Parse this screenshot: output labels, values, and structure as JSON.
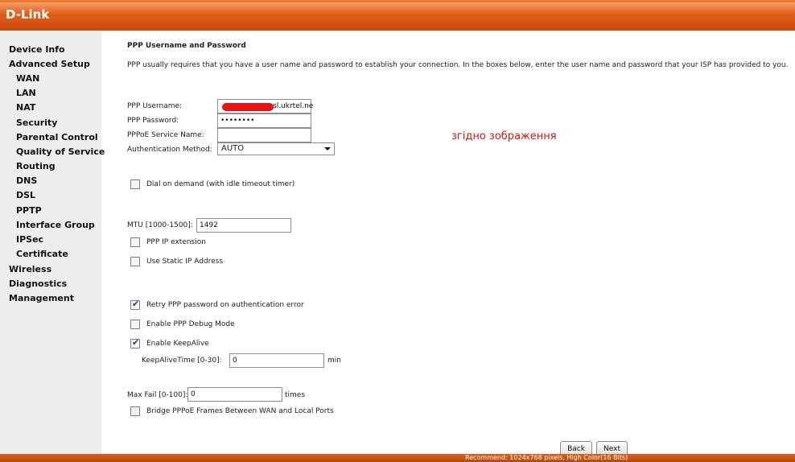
{
  "header": {
    "logo": "D-Link"
  },
  "sidebar": {
    "items": [
      {
        "label": "Device Info"
      },
      {
        "label": "Advanced Setup"
      },
      {
        "label": "WAN"
      },
      {
        "label": "LAN"
      },
      {
        "label": "NAT"
      },
      {
        "label": "Security"
      },
      {
        "label": "Parental Control"
      },
      {
        "label": "Quality of Service"
      },
      {
        "label": "Routing"
      },
      {
        "label": "DNS"
      },
      {
        "label": "DSL"
      },
      {
        "label": "PPTP"
      },
      {
        "label": "Interface Group"
      },
      {
        "label": "IPSec"
      },
      {
        "label": "Certificate"
      },
      {
        "label": "Wireless"
      },
      {
        "label": "Diagnostics"
      },
      {
        "label": "Management"
      }
    ]
  },
  "main": {
    "title": "PPP Username and Password",
    "description": "PPP usually requires that you have a user name and password to establish your connection. In the boxes below, enter the user name and password that your ISP has provided to you.",
    "username_label": "PPP Username:",
    "username_value": "sl.ukrtel.ne",
    "password_label": "PPP Password:",
    "password_value": "••••••••",
    "service_label": "PPPoE Service Name:",
    "service_value": "",
    "auth_label": "Authentication Method:",
    "auth_value": "AUTO",
    "annotation": "згідно зображення",
    "dial_on_demand_label": "Dial on demand (with idle timeout timer)",
    "mtu_label": "MTU [1000-1500]:",
    "mtu_value": "1492",
    "ppp_ip_ext_label": "PPP IP extension",
    "static_ip_label": "Use Static IP Address",
    "retry_label": "Retry PPP password on authentication error",
    "debug_label": "Enable PPP Debug Mode",
    "keepalive_label": "Enable KeepAlive",
    "keepalive_time_label": "KeepAliveTime [0-30]:",
    "keepalive_time_value": "0",
    "keepalive_unit": "min",
    "maxfail_label": "Max Fail [0-100]:",
    "maxfail_value": "0",
    "maxfail_unit": "times",
    "bridge_label": "Bridge PPPoE Frames Between WAN and Local Ports"
  },
  "checkboxes": {
    "dial_on_demand": false,
    "ppp_ip_extension": false,
    "use_static_ip": false,
    "retry_ppp_password": true,
    "enable_debug": false,
    "enable_keepalive": true,
    "bridge_pppoe": false
  },
  "buttons": {
    "back": "Back",
    "next": "Next"
  },
  "footer": {
    "text": "Recommend: 1024x768 pixels, High Color(16 Bits)"
  },
  "colors": {
    "brand": "#e0601a",
    "annotation": "#e01111",
    "redaction": "#e81212"
  }
}
